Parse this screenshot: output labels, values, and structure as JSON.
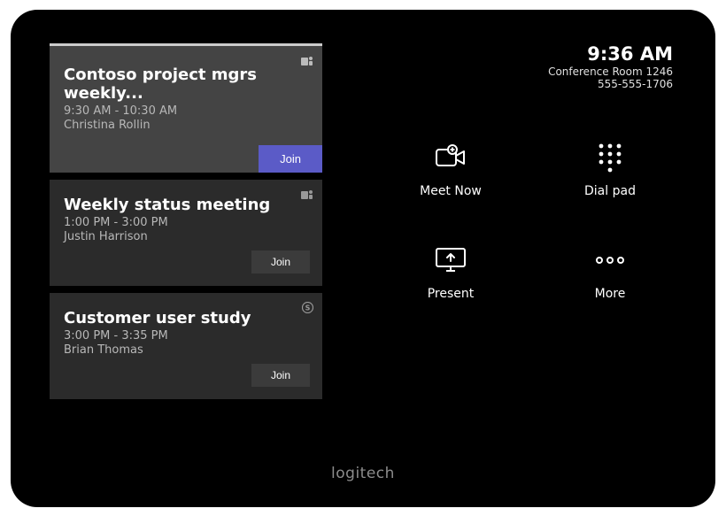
{
  "status": {
    "time": "9:36 AM",
    "room": "Conference Room 1246",
    "phone": "555-555-1706"
  },
  "meetings": [
    {
      "title": "Contoso project mgrs weekly...",
      "time": "9:30 AM - 10:30 AM",
      "organizer": "Christina Rollin",
      "join_label": "Join",
      "provider": "teams",
      "active": true
    },
    {
      "title": "Weekly status meeting",
      "time": "1:00 PM - 3:00 PM",
      "organizer": "Justin Harrison",
      "join_label": "Join",
      "provider": "teams",
      "active": false
    },
    {
      "title": "Customer user study",
      "time": "3:00 PM - 3:35 PM",
      "organizer": "Brian Thomas",
      "join_label": "Join",
      "provider": "skype",
      "active": false
    }
  ],
  "actions": {
    "meet_now": "Meet Now",
    "dialpad": "Dial pad",
    "present": "Present",
    "more": "More"
  },
  "brand": "logitech"
}
